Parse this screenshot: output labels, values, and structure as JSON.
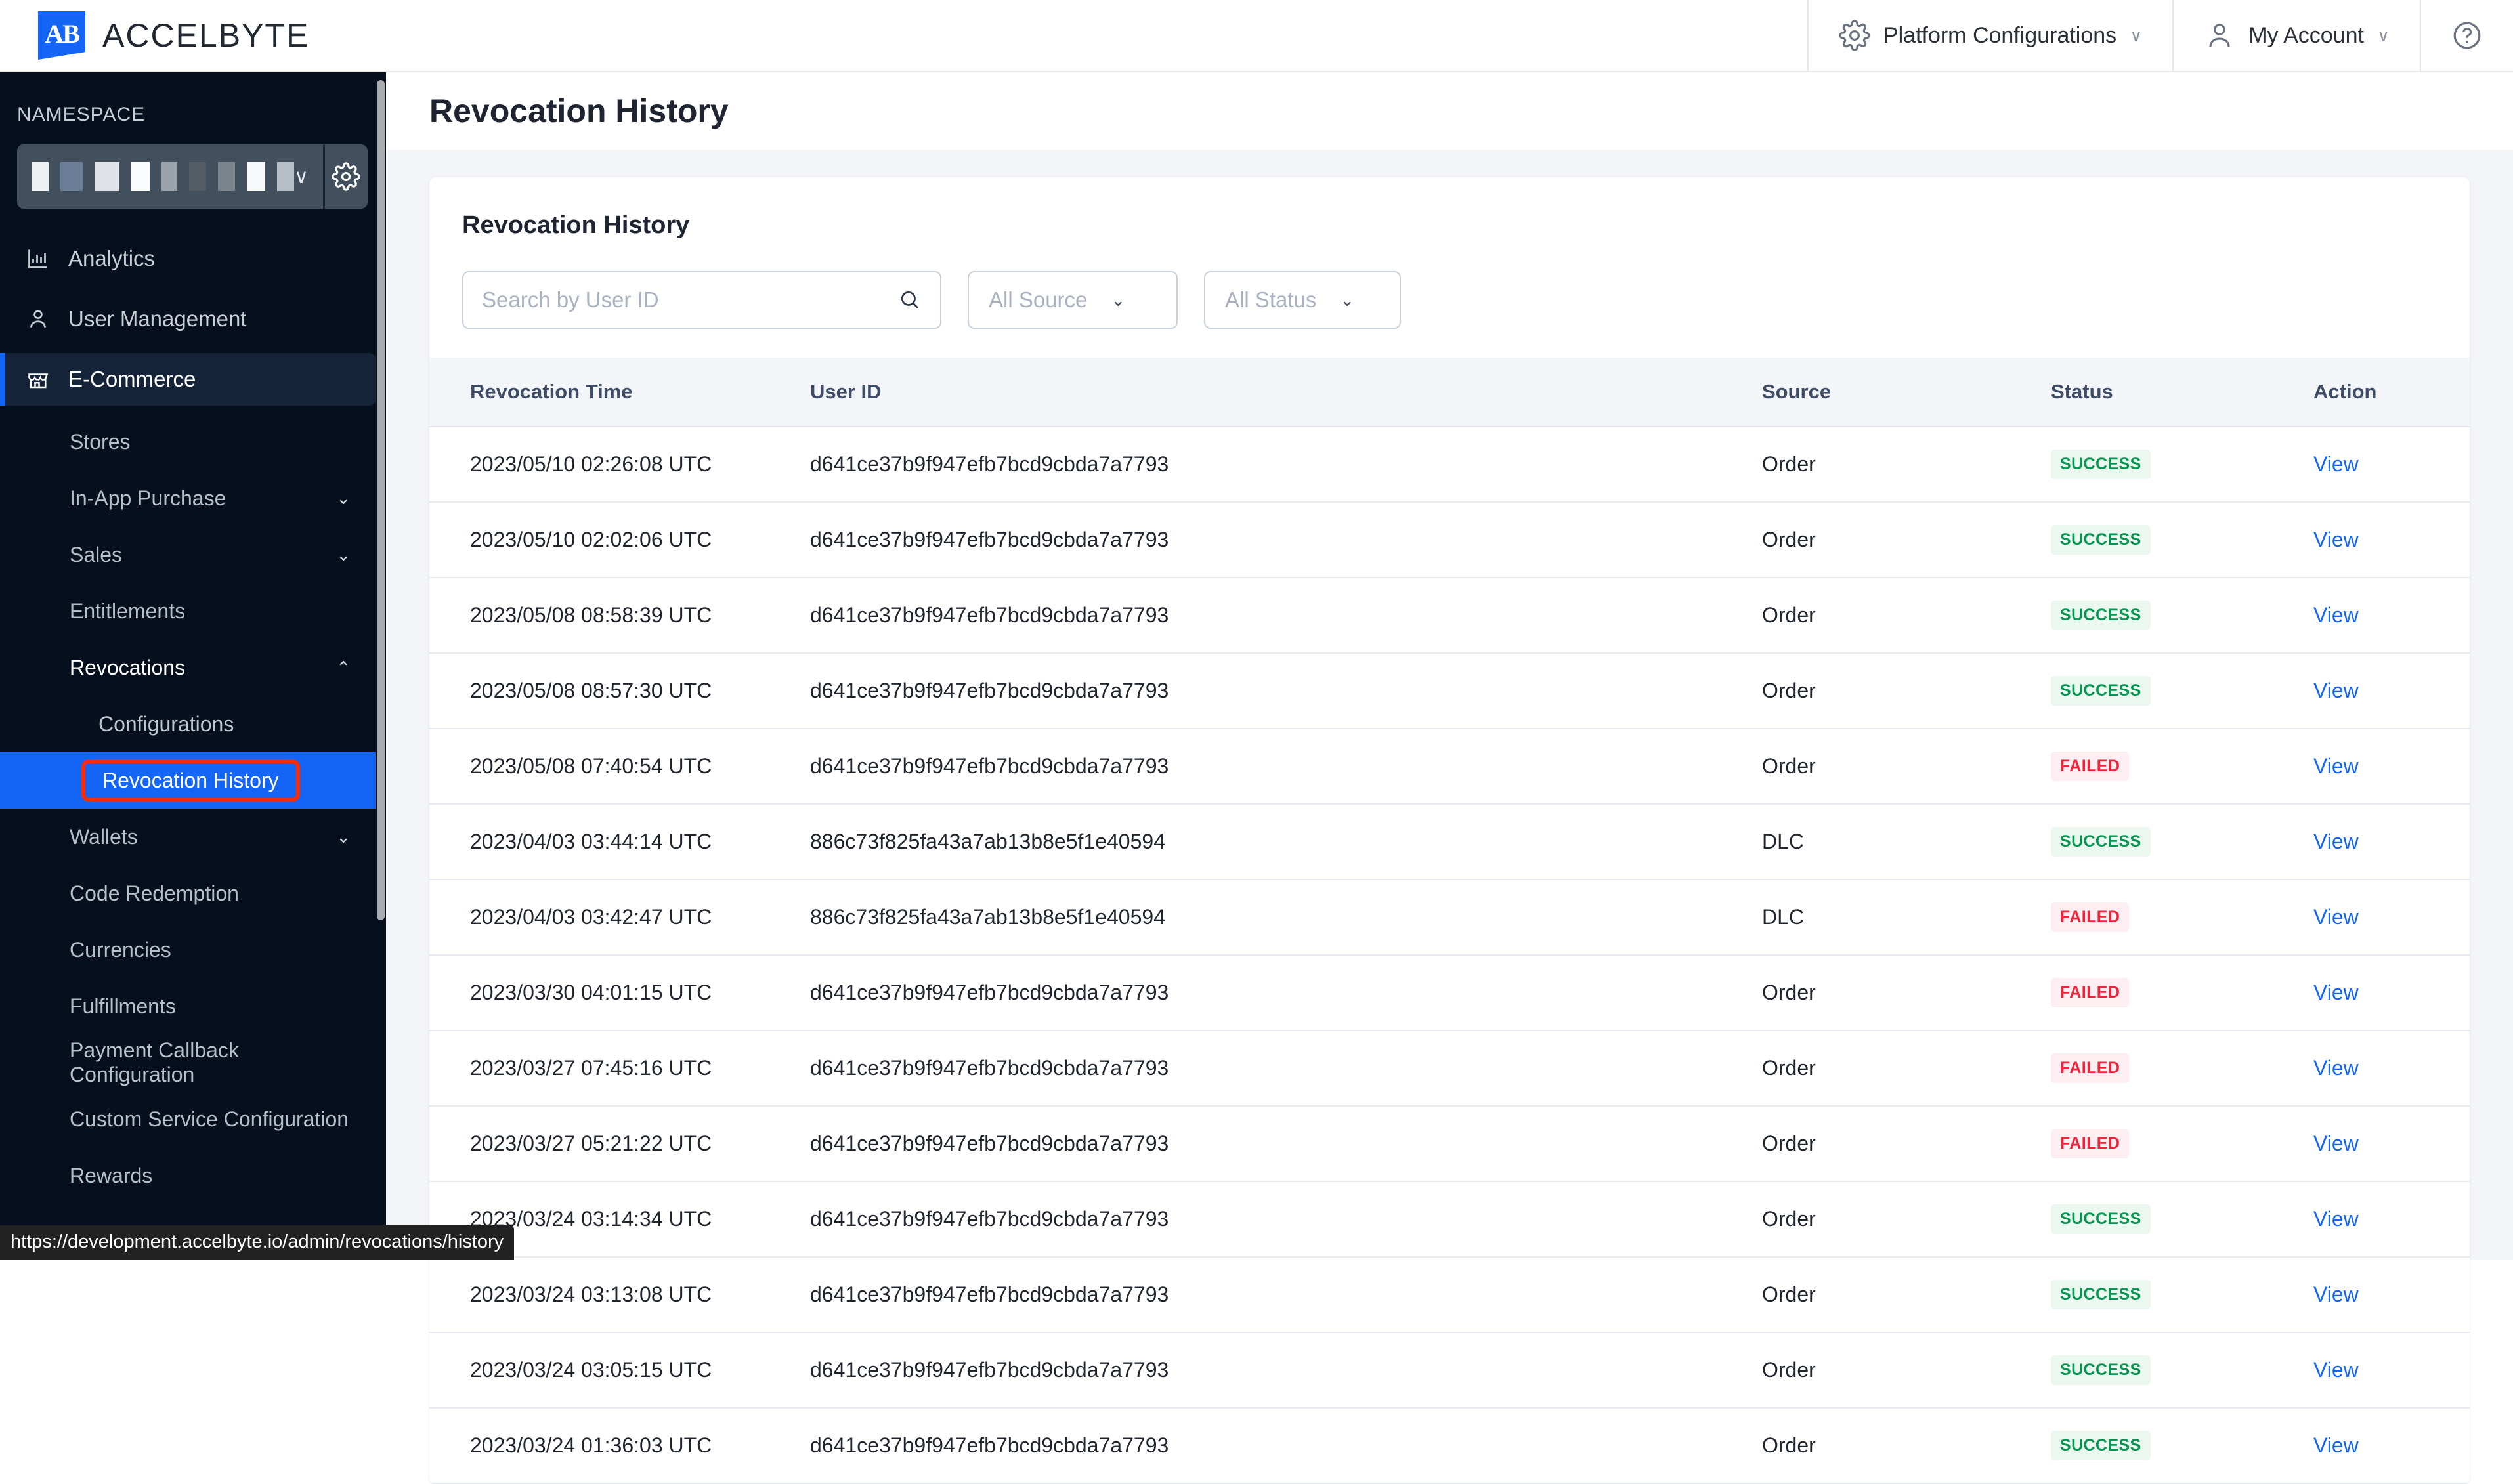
{
  "topbar": {
    "brand_name": "ACCELBYTE",
    "logo_text": "AB",
    "platform_configurations_label": "Platform Configurations",
    "my_account_label": "My Account",
    "chevron": "∨",
    "accent_color": "#1464f6"
  },
  "sidebar": {
    "namespace_label": "NAMESPACE",
    "namespace_value_redacted": "",
    "chevron_down": "∨",
    "top_items": [
      {
        "label": "Analytics",
        "icon": "bar-chart-icon",
        "active": false
      },
      {
        "label": "User Management",
        "icon": "user-icon",
        "active": false
      },
      {
        "label": "E-Commerce",
        "icon": "storefront-icon",
        "active": true
      }
    ],
    "sub_items": [
      {
        "label": "Stores",
        "expandable": false
      },
      {
        "label": "In-App Purchase",
        "expandable": true,
        "chevron": "⌄"
      },
      {
        "label": "Sales",
        "expandable": true,
        "chevron": "⌄"
      },
      {
        "label": "Entitlements",
        "expandable": false
      },
      {
        "label": "Revocations",
        "expandable": true,
        "chevron": "⌃",
        "expanded": true
      }
    ],
    "revocation_children": [
      {
        "label": "Configurations",
        "selected": false
      },
      {
        "label": "Revocation History",
        "selected": true,
        "highlighted": true
      }
    ],
    "sub_items_after": [
      {
        "label": "Wallets",
        "expandable": true,
        "chevron": "⌄"
      },
      {
        "label": "Code Redemption",
        "expandable": false
      },
      {
        "label": "Currencies",
        "expandable": false
      },
      {
        "label": "Fulfillments",
        "expandable": false
      },
      {
        "label": "Payment Callback Configuration",
        "expandable": false
      },
      {
        "label": "Custom Service Configuration",
        "expandable": false
      },
      {
        "label": "Rewards",
        "expandable": false
      }
    ],
    "selection_ring_color": "#ff2a00",
    "selected_bg_color": "#1464f6"
  },
  "main": {
    "page_title": "Revocation History",
    "card_title": "Revocation History",
    "search": {
      "placeholder": "Search by User ID",
      "value": "",
      "icon": "search-icon"
    },
    "source_filter": {
      "value": "All Source",
      "chevron": "⌄"
    },
    "status_filter": {
      "value": "All Status",
      "chevron": "⌄"
    },
    "table": {
      "columns": [
        "Revocation Time",
        "User ID",
        "Source",
        "Status",
        "Action"
      ],
      "action_label": "View",
      "rows": [
        {
          "time": "2023/05/10 02:26:08 UTC",
          "user_id": "d641ce37b9f947efb7bcd9cbda7a7793",
          "source": "Order",
          "status": "SUCCESS"
        },
        {
          "time": "2023/05/10 02:02:06 UTC",
          "user_id": "d641ce37b9f947efb7bcd9cbda7a7793",
          "source": "Order",
          "status": "SUCCESS"
        },
        {
          "time": "2023/05/08 08:58:39 UTC",
          "user_id": "d641ce37b9f947efb7bcd9cbda7a7793",
          "source": "Order",
          "status": "SUCCESS"
        },
        {
          "time": "2023/05/08 08:57:30 UTC",
          "user_id": "d641ce37b9f947efb7bcd9cbda7a7793",
          "source": "Order",
          "status": "SUCCESS"
        },
        {
          "time": "2023/05/08 07:40:54 UTC",
          "user_id": "d641ce37b9f947efb7bcd9cbda7a7793",
          "source": "Order",
          "status": "FAILED"
        },
        {
          "time": "2023/04/03 03:44:14 UTC",
          "user_id": "886c73f825fa43a7ab13b8e5f1e40594",
          "source": "DLC",
          "status": "SUCCESS"
        },
        {
          "time": "2023/04/03 03:42:47 UTC",
          "user_id": "886c73f825fa43a7ab13b8e5f1e40594",
          "source": "DLC",
          "status": "FAILED"
        },
        {
          "time": "2023/03/30 04:01:15 UTC",
          "user_id": "d641ce37b9f947efb7bcd9cbda7a7793",
          "source": "Order",
          "status": "FAILED"
        },
        {
          "time": "2023/03/27 07:45:16 UTC",
          "user_id": "d641ce37b9f947efb7bcd9cbda7a7793",
          "source": "Order",
          "status": "FAILED"
        },
        {
          "time": "2023/03/27 05:21:22 UTC",
          "user_id": "d641ce37b9f947efb7bcd9cbda7a7793",
          "source": "Order",
          "status": "FAILED"
        },
        {
          "time": "2023/03/24 03:14:34 UTC",
          "user_id": "d641ce37b9f947efb7bcd9cbda7a7793",
          "source": "Order",
          "status": "SUCCESS"
        },
        {
          "time": "2023/03/24 03:13:08 UTC",
          "user_id": "d641ce37b9f947efb7bcd9cbda7a7793",
          "source": "Order",
          "status": "SUCCESS"
        },
        {
          "time": "2023/03/24 03:05:15 UTC",
          "user_id": "d641ce37b9f947efb7bcd9cbda7a7793",
          "source": "Order",
          "status": "SUCCESS"
        },
        {
          "time": "2023/03/24 01:36:03 UTC",
          "user_id": "d641ce37b9f947efb7bcd9cbda7a7793",
          "source": "Order",
          "status": "SUCCESS"
        }
      ]
    },
    "status_colors": {
      "success": "#0a9452",
      "failed": "#f0233b",
      "link": "#1464f6"
    }
  },
  "status_bar": {
    "url": "https://development.accelbyte.io/admin/revocations/history"
  }
}
